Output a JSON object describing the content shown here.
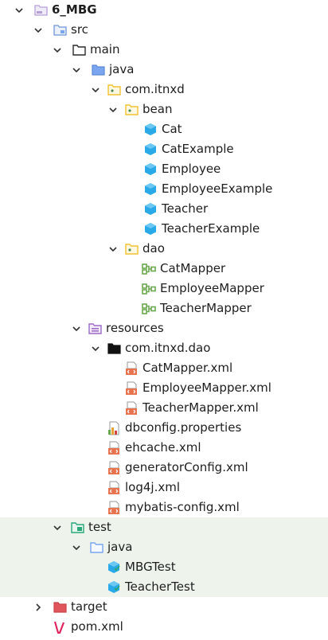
{
  "project": {
    "name": "6_MBG",
    "src": "src",
    "main": "main",
    "java": "java",
    "package_root": "com.itnxd",
    "bean": {
      "folder": "bean",
      "classes": [
        "Cat",
        "CatExample",
        "Employee",
        "EmployeeExample",
        "Teacher",
        "TeacherExample"
      ]
    },
    "dao": {
      "folder": "dao",
      "interfaces": [
        "CatMapper",
        "EmployeeMapper",
        "TeacherMapper"
      ]
    },
    "resources": {
      "folder": "resources",
      "package": "com.itnxd.dao",
      "mapper_xml": [
        "CatMapper.xml",
        "EmployeeMapper.xml",
        "TeacherMapper.xml"
      ],
      "files": [
        "dbconfig.properties",
        "ehcache.xml",
        "generatorConfig.xml",
        "log4j.xml",
        "mybatis-config.xml"
      ]
    },
    "test": {
      "folder": "test",
      "java": "java",
      "classes": [
        "MBGTest",
        "TeacherTest"
      ]
    },
    "target": "target",
    "pom": "pom.xml"
  },
  "colors": {
    "highlight_background": "#eef4ec",
    "class_icon": "#29a9e8",
    "interface_icon": "#6aa84f",
    "xml_icon": "#e8744f",
    "folder_target": "#e0545c",
    "folder_blue": "#7aa6f0",
    "package_folder": "#f2c232",
    "module_folder": "#b7a0d8",
    "maven_pom": "#e0245e"
  }
}
